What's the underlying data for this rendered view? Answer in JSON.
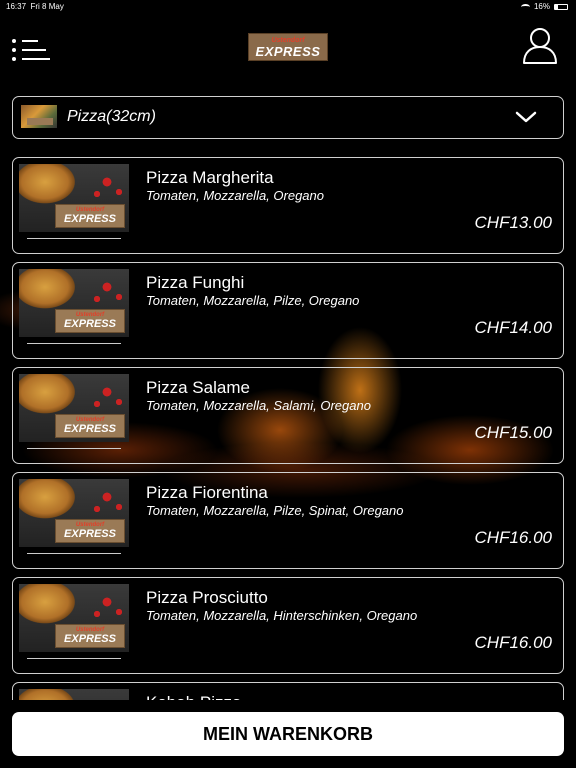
{
  "status": {
    "time": "16:37",
    "date": "Fri 8 May",
    "battery": "16%"
  },
  "header": {
    "logo_top": "Ustendorf",
    "logo_main": "EXPRESS",
    "icons": {
      "menu": "menu-icon",
      "user": "user-icon"
    }
  },
  "category": {
    "selected": "Pizza(32cm)",
    "icon": "chevron-down-icon"
  },
  "items": [
    {
      "name": "Pizza Margherita",
      "description": "Tomaten, Mozzarella, Oregano",
      "price": "CHF13.00"
    },
    {
      "name": "Pizza Funghi",
      "description": "Tomaten, Mozzarella, Pilze, Oregano",
      "price": "CHF14.00"
    },
    {
      "name": "Pizza Salame",
      "description": "Tomaten, Mozzarella, Salami, Oregano",
      "price": "CHF15.00"
    },
    {
      "name": "Pizza Fiorentina",
      "description": "Tomaten, Mozzarella, Pilze, Spinat, Oregano",
      "price": "CHF16.00"
    },
    {
      "name": "Pizza Prosciutto",
      "description": "Tomaten, Mozzarella, Hinterschinken, Oregano",
      "price": "CHF16.00"
    },
    {
      "name": "Kebab Pizza",
      "description": "",
      "price": ""
    }
  ],
  "cart": {
    "label": "MEIN WARENKORB"
  }
}
